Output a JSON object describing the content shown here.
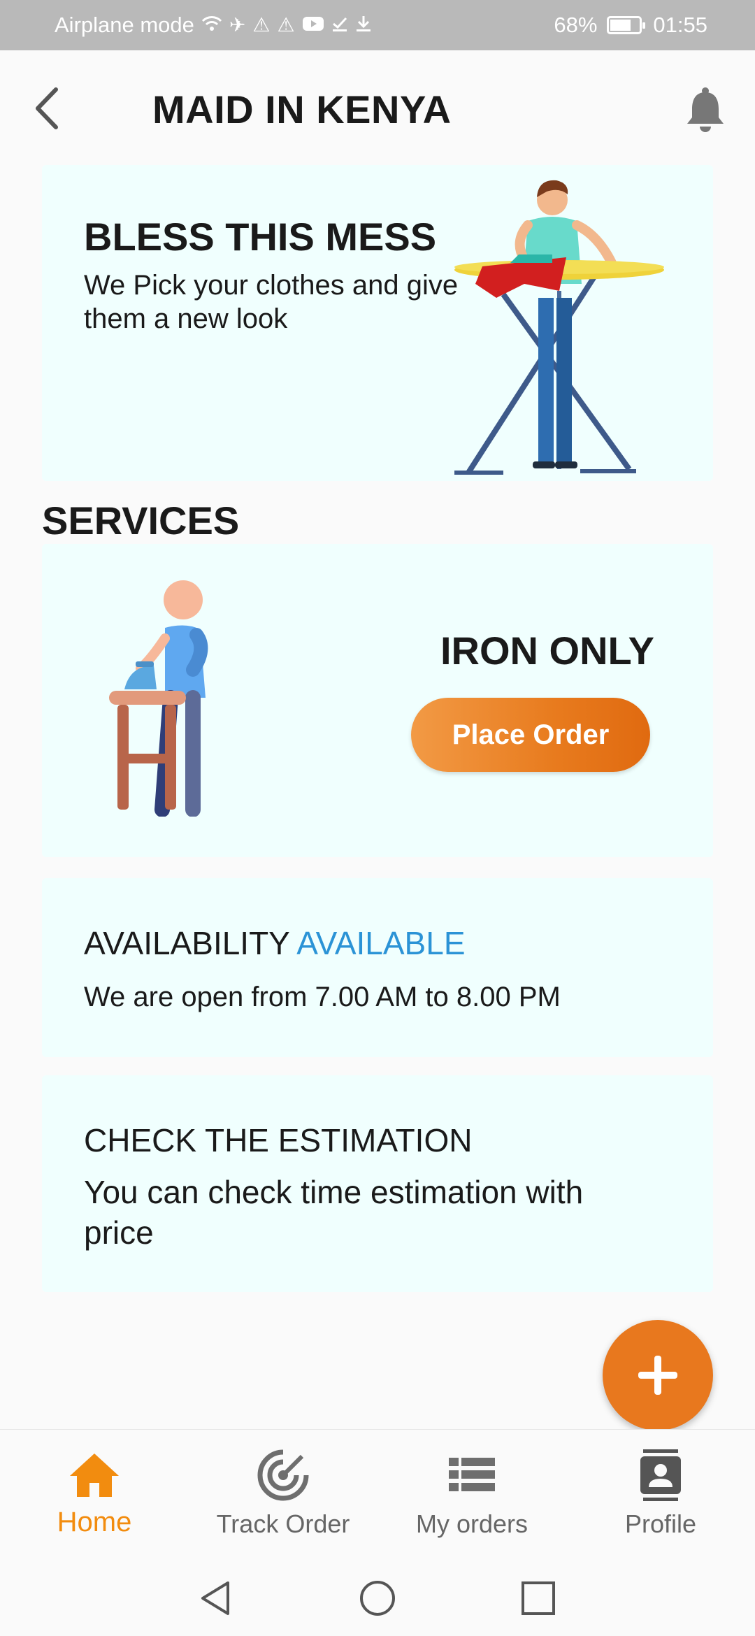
{
  "status_bar": {
    "left_text": "Airplane mode",
    "battery": "68%",
    "time": "01:55",
    "icons": [
      "wifi-icon",
      "airplane-icon",
      "warning-icon",
      "warning-icon",
      "youtube-icon",
      "check-icon",
      "download-icon"
    ]
  },
  "header": {
    "title": "MAID IN KENYA",
    "back_icon": "chevron-left-icon",
    "notification_icon": "bell-icon"
  },
  "hero": {
    "title": "BLESS THIS MESS",
    "subtitle": "We Pick your clothes and give\n them a new look"
  },
  "services": {
    "section_title": "SERVICES",
    "items": [
      {
        "name": "IRON ONLY",
        "button_label": "Place Order"
      }
    ]
  },
  "availability": {
    "label": "AVAILABILITY",
    "status": "AVAILABLE",
    "hours": "We are open from 7.00 AM to 8.00 PM"
  },
  "estimation": {
    "title": "CHECK THE ESTIMATION",
    "text": "You can check time estimation with price"
  },
  "fab": {
    "icon": "plus-icon"
  },
  "bottom_nav": {
    "items": [
      {
        "label": "Home",
        "icon": "home-icon",
        "active": true
      },
      {
        "label": "Track Order",
        "icon": "radar-icon",
        "active": false
      },
      {
        "label": "My orders",
        "icon": "list-icon",
        "active": false
      },
      {
        "label": "Profile",
        "icon": "profile-icon",
        "active": false
      }
    ]
  },
  "colors": {
    "accent": "#e8781e",
    "active_tab": "#f28c0f",
    "available": "#2b93d6",
    "card_bg": "#f0fffe",
    "status_bar": "#b9b9b9"
  }
}
